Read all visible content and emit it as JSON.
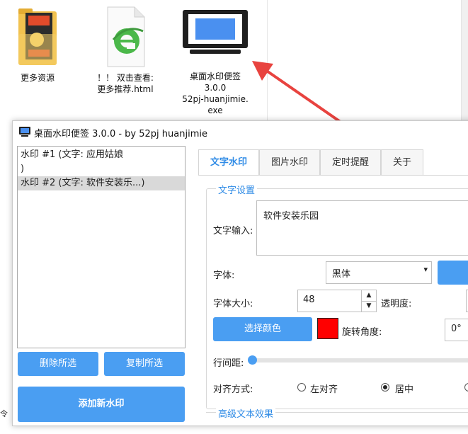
{
  "desktop": {
    "icons": [
      {
        "label": "更多资源"
      },
      {
        "label1": "！！ 双击查看:",
        "label2": "更多推荐.html"
      },
      {
        "label1": "桌面水印便签",
        "label2": "3.0.0",
        "label3": "52pj-huanjimie.",
        "label4": "exe"
      }
    ]
  },
  "window": {
    "title": "桌面水印便签 3.0.0 - by 52pj huanjimie",
    "list": [
      {
        "line1": "水印 #1 (文字: 应用姑娘",
        "line2": ")"
      },
      {
        "line1": "水印 #2 (文字: 软件安装乐...)"
      }
    ],
    "buttons": {
      "delete": "删除所选",
      "copy": "复制所选",
      "add": "添加新水印"
    },
    "tabs": [
      "文字水印",
      "图片水印",
      "定时提醒",
      "关于"
    ],
    "text_settings": {
      "group_title": "文字设置",
      "text_input_label": "文字输入:",
      "text_input_value": "软件安装乐园",
      "font_label": "字体:",
      "font_value": "黑体",
      "size_label": "字体大小:",
      "size_value": "48",
      "opacity_label": "透明度:",
      "color_button": "选择颜色",
      "selected_color": "#ff0000",
      "rotation_label": "旋转角度:",
      "rotation_value": "0°",
      "line_spacing_label": "行间距:",
      "align_label": "对齐方式:",
      "align_left": "左对齐",
      "align_center": "居中",
      "selected_align": "center"
    },
    "advanced_group_title": "高级文本效果"
  },
  "accent_color": "#4a9ef2",
  "tab_active_color": "#2f8be6"
}
